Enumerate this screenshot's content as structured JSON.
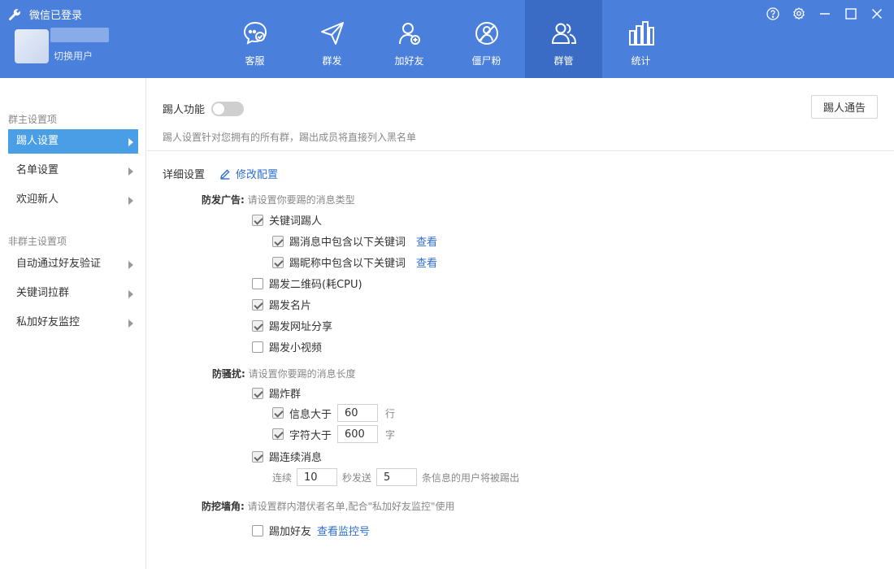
{
  "header": {
    "app_title": "微信已登录",
    "switch_user": "切换用户",
    "tabs": [
      {
        "label": "客服",
        "icon": "chat-bubble-icon"
      },
      {
        "label": "群发",
        "icon": "paper-plane-icon"
      },
      {
        "label": "加好友",
        "icon": "add-user-icon"
      },
      {
        "label": "僵尸粉",
        "icon": "zombie-fan-icon"
      },
      {
        "label": "群管",
        "icon": "group-users-icon",
        "active": true
      },
      {
        "label": "统计",
        "icon": "bar-chart-icon"
      }
    ],
    "window_controls": [
      "help-icon",
      "settings-icon",
      "minimize-icon",
      "maximize-icon",
      "close-icon"
    ],
    "colors": {
      "header_bg": "#4a7fdc",
      "active_tab_bg": "#3a6cc6"
    }
  },
  "sidebar": {
    "group1": "群主设置项",
    "group1_items": [
      {
        "label": "踢人设置",
        "active": true
      },
      {
        "label": "名单设置"
      },
      {
        "label": "欢迎新人"
      }
    ],
    "group2": "非群主设置项",
    "group2_items": [
      {
        "label": "自动通过好友验证"
      },
      {
        "label": "关键词拉群"
      },
      {
        "label": "私加好友监控"
      }
    ]
  },
  "main": {
    "kick_function_label": "踢人功能",
    "kick_function_on": false,
    "notice_button": "踢人通告",
    "description": "踢人设置针对您拥有的所有群，踢出成员将直接列入黑名单",
    "detail_label": "详细设置",
    "edit_config": "修改配置",
    "anti_ad": {
      "title": "防发广告:",
      "hint": "请设置你要踢的消息类型",
      "keyword_kick": {
        "label": "关键词踢人",
        "checked": true
      },
      "msg_keyword": {
        "label": "踢消息中包含以下关键词",
        "checked": true,
        "link": "查看"
      },
      "nick_keyword": {
        "label": "踢昵称中包含以下关键词",
        "checked": true,
        "link": "查看"
      },
      "qrcode": {
        "label": "踢发二维码(耗CPU)",
        "checked": false
      },
      "card": {
        "label": "踢发名片",
        "checked": true
      },
      "url_share": {
        "label": "踢发网址分享",
        "checked": true
      },
      "short_video": {
        "label": "踢发小视频",
        "checked": false
      }
    },
    "anti_spam": {
      "title": "防骚扰:",
      "hint": "请设置你要踢的消息长度",
      "flood": {
        "label": "踢炸群",
        "checked": true
      },
      "msg_over": {
        "label": "信息大于",
        "checked": true,
        "value": "60",
        "unit": "行"
      },
      "char_over": {
        "label": "字符大于",
        "checked": true,
        "value": "600",
        "unit": "字"
      },
      "continuous": {
        "label": "踢连续消息",
        "checked": true
      },
      "continuous_prefix": "连续",
      "continuous_seconds": "10",
      "continuous_mid": "秒发送",
      "continuous_count": "5",
      "continuous_suffix": "条信息的用户将被踢出"
    },
    "anti_poach": {
      "title": "防挖墙角:",
      "hint": "请设置群内潜伏者名单,配合\"私加好友监控\"使用",
      "add_friend": {
        "label": "踢加好友",
        "checked": false
      },
      "view_monitor": "查看监控号"
    }
  }
}
